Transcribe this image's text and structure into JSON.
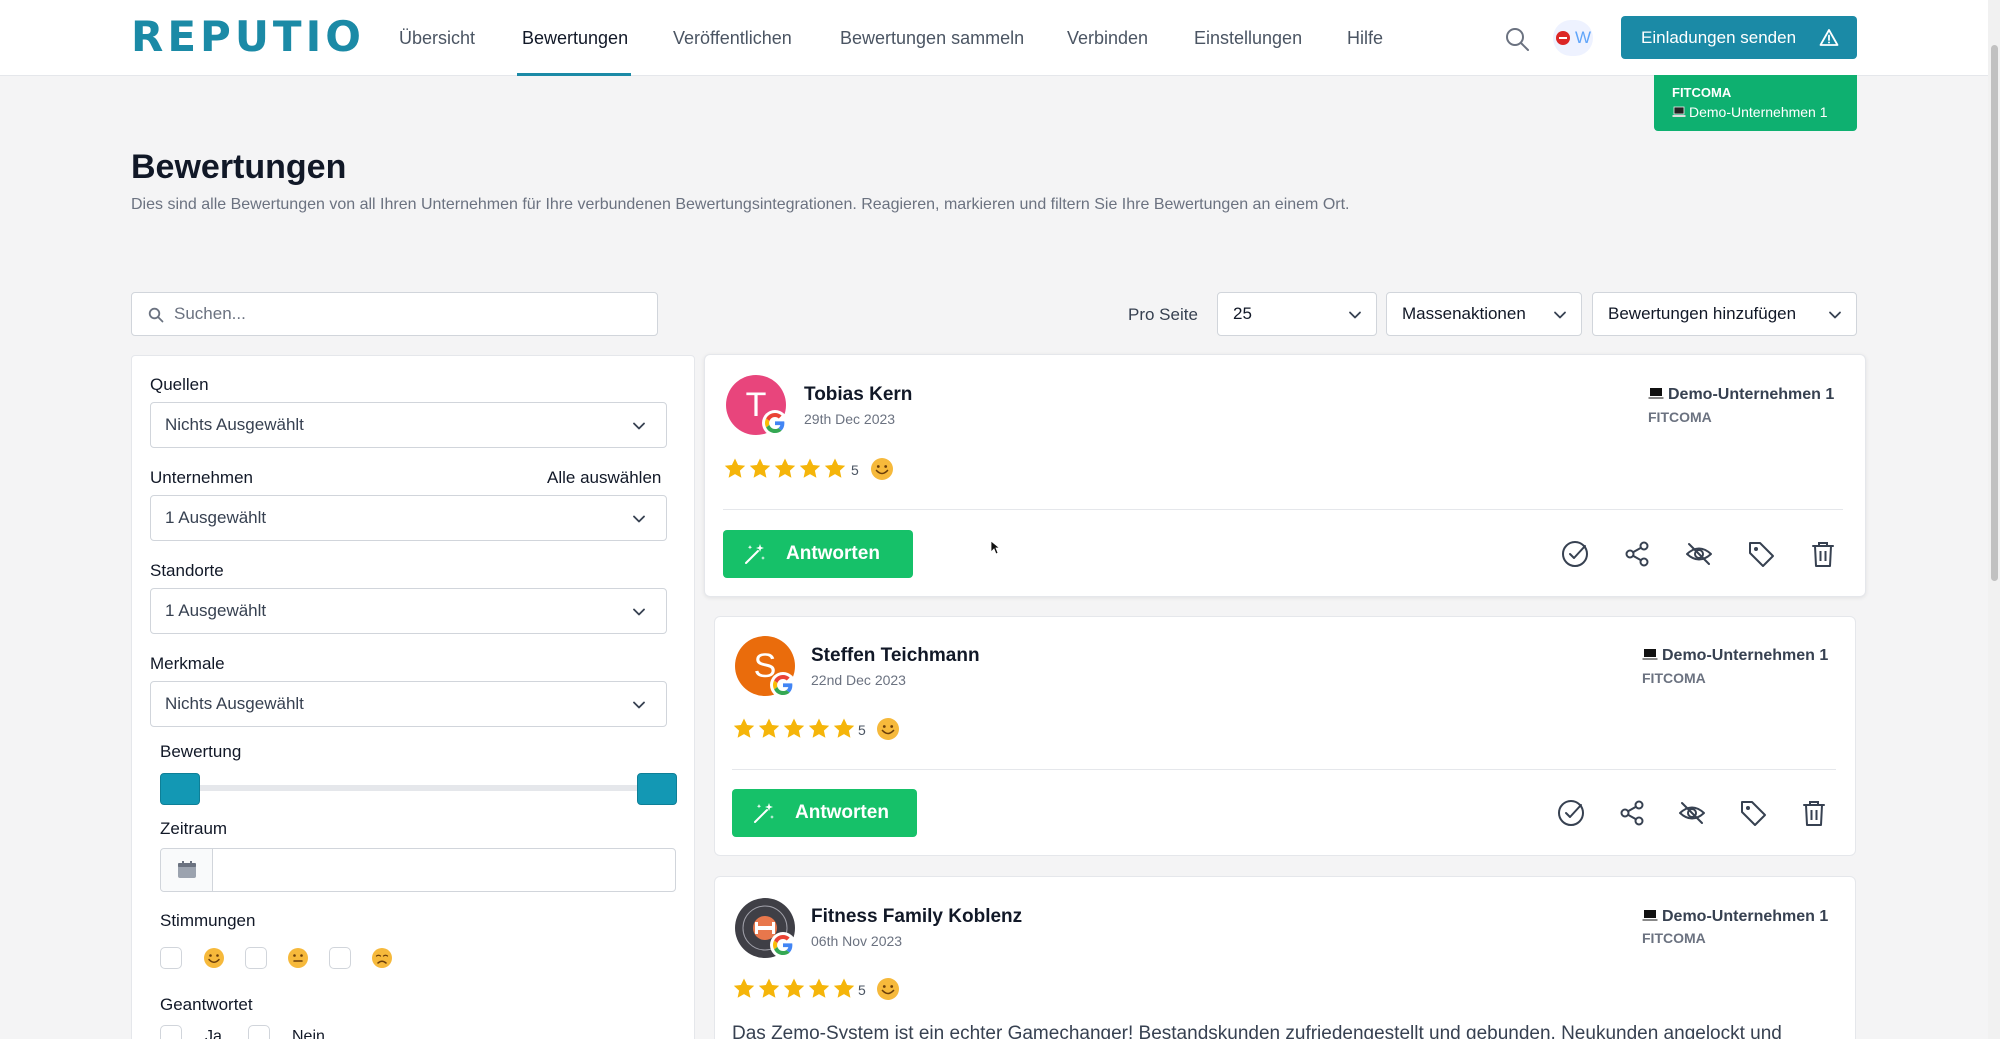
{
  "nav": {
    "logo": "REPUTIO",
    "items": [
      "Übersicht",
      "Bewertungen",
      "Veröffentlichen",
      "Bewertungen sammeln",
      "Verbinden",
      "Einstellungen",
      "Hilfe"
    ],
    "active_item": "Bewertungen",
    "language_letter": "W",
    "invite_button": "Einladungen senden",
    "icons": [
      "search-icon",
      "language-flag-icon",
      "warning-icon"
    ]
  },
  "company_badge": {
    "org": "FITCOMA",
    "company": "Demo-Unternehmen 1"
  },
  "page": {
    "title": "Bewertungen",
    "subtitle": "Dies sind alle Bewertungen von all Ihren Unternehmen für Ihre verbundenen Bewertungsintegrationen. Reagieren, markieren und filtern Sie Ihre Bewertungen an einem Ort."
  },
  "toolbar": {
    "search_placeholder": "Suchen...",
    "per_page_label": "Pro Seite",
    "per_page_value": "25",
    "bulk_actions": "Massenaktionen",
    "add_reviews": "Bewertungen hinzufügen"
  },
  "filters": {
    "sources_label": "Quellen",
    "sources_value": "Nichts Ausgewählt",
    "companies_label": "Unternehmen",
    "select_all": "Alle auswählen",
    "companies_value": "1 Ausgewählt",
    "locations_label": "Standorte",
    "locations_value": "1 Ausgewählt",
    "features_label": "Merkmale",
    "features_value": "Nichts Ausgewählt",
    "rating_label": "Bewertung",
    "rating_range": [
      1,
      5
    ],
    "period_label": "Zeitraum",
    "period_value": "",
    "moods_label": "Stimmungen",
    "moods": [
      "positive",
      "neutral",
      "negative"
    ],
    "answered_label": "Geantwortet",
    "answered_options": [
      "Ja",
      "Nein"
    ]
  },
  "reviews": [
    {
      "name": "Tobias Kern",
      "initial": "T",
      "avatar_color": "#e8457c",
      "date": "29th Dec 2023",
      "company": "Demo-Unternehmen 1",
      "org": "FITCOMA",
      "stars": 5,
      "score": "5",
      "reply_label": "Antworten",
      "text": ""
    },
    {
      "name": "Steffen Teichmann",
      "initial": "S",
      "avatar_color": "#ea6c0c",
      "date": "22nd Dec 2023",
      "company": "Demo-Unternehmen 1",
      "org": "FITCOMA",
      "stars": 5,
      "score": "5",
      "reply_label": "Antworten",
      "text": ""
    },
    {
      "name": "Fitness Family Koblenz",
      "initial": "",
      "avatar_color": "#3f3f46",
      "date": "06th Nov 2023",
      "company": "Demo-Unternehmen 1",
      "org": "FITCOMA",
      "stars": 5,
      "score": "5",
      "reply_label": "",
      "text": "Das Zemo-System ist ein echter Gamechanger! Bestandskunden zufriedengestellt und gebunden, Neukunden angelockt und"
    }
  ],
  "colors": {
    "brand": "#1b8aa6",
    "reply_green": "#16c169",
    "badge_green": "#0eb070",
    "star": "#f5b50a"
  }
}
